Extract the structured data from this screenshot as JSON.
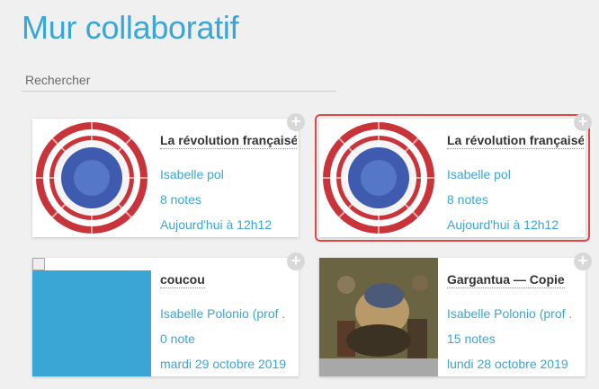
{
  "page": {
    "title": "Mur collaboratif"
  },
  "search": {
    "placeholder": "Rechercher"
  },
  "cards": [
    {
      "title": "La révolution françaisé",
      "author": "Isabelle pol",
      "notes": "8 notes",
      "date": "Aujourd'hui à 12h12",
      "thumbnail": "cocarde-tricolore",
      "selected": false
    },
    {
      "title": "La révolution françaisé",
      "author": "Isabelle pol",
      "notes": "8 notes",
      "date": "Aujourd'hui à 12h12",
      "thumbnail": "cocarde-tricolore",
      "selected": true
    },
    {
      "title": "coucou",
      "author": "Isabelle Polonio (prof .",
      "notes": "0 note",
      "date": "mardi 29 octobre 2019",
      "thumbnail": "broken-image",
      "selected": false
    },
    {
      "title": "Gargantua — Copie",
      "author": "Isabelle Polonio (prof .",
      "notes": "15 notes",
      "date": "lundi 28 octobre 2019",
      "thumbnail": "painting",
      "selected": false
    }
  ],
  "add_button_label": "+",
  "colors": {
    "accent": "#3aa6d6",
    "selection": "#e04848",
    "background": "#f0f0f0"
  }
}
